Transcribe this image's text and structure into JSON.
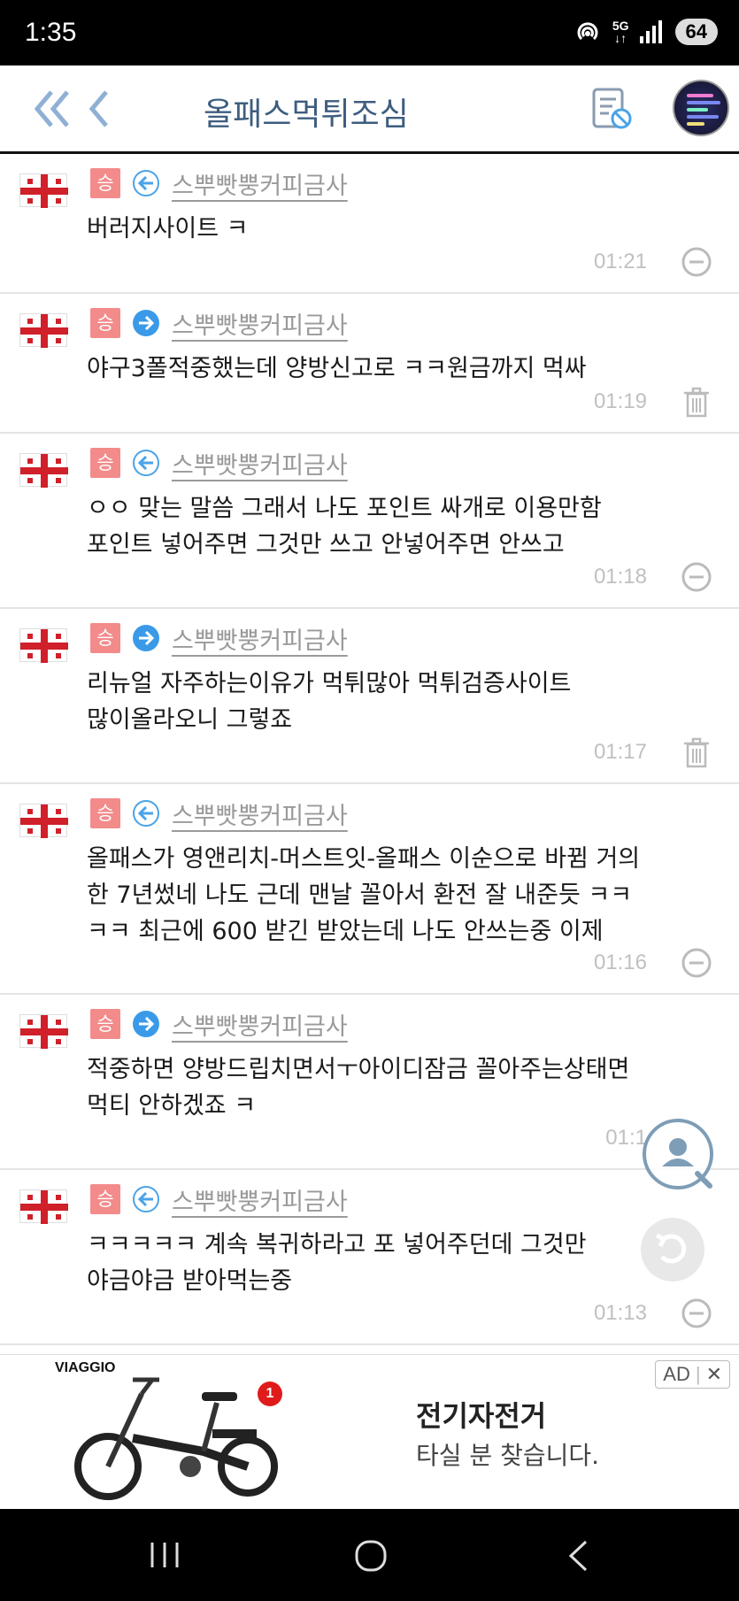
{
  "status_bar": {
    "time": "1:35",
    "network": "5G",
    "battery": "64"
  },
  "header": {
    "title": "올패스먹튀조심"
  },
  "comments": [
    {
      "badge": "승",
      "arrow": "left",
      "nickname": "스뿌빳뿡커피금사",
      "text": "버러지사이트 ㅋ",
      "time": "01:21",
      "action": "minus"
    },
    {
      "badge": "승",
      "arrow": "right",
      "nickname": "스뿌빳뿡커피금사",
      "text": "야구3폴적중했는데 양방신고로 ㅋㅋ원금까지 먹싸",
      "time": "01:19",
      "action": "trash"
    },
    {
      "badge": "승",
      "arrow": "left",
      "nickname": "스뿌빳뿡커피금사",
      "text": "ㅇㅇ 맞는 말씀 그래서 나도 포인트 싸개로 이용만함\n포인트 넣어주면 그것만 쓰고 안넣어주면 안쓰고",
      "time": "01:18",
      "action": "minus"
    },
    {
      "badge": "승",
      "arrow": "right",
      "nickname": "스뿌빳뿡커피금사",
      "text": "리뉴얼 자주하는이유가 먹튀많아 먹튀검증사이트\n많이올라오니 그렇죠",
      "time": "01:17",
      "action": "trash"
    },
    {
      "badge": "승",
      "arrow": "left",
      "nickname": "스뿌빳뿡커피금사",
      "text": "올패스가 영앤리치-머스트잇-올패스 이순으로 바뀜 거의\n한 7년썼네 나도 근데 맨날 꼴아서 환전 잘 내준듯 ㅋㅋ\nㅋㅋ 최근에 600 받긴 받았는데 나도 안쓰는중 이제",
      "time": "01:16",
      "action": "minus"
    },
    {
      "badge": "승",
      "arrow": "right",
      "nickname": "스뿌빳뿡커피금사",
      "text": "적중하면 양방드립치면서ㅜ아이디잠금  꼴아주는상태면\n먹티 안하겠죠 ㅋ",
      "time": "01:1",
      "action": "none"
    },
    {
      "badge": "승",
      "arrow": "left",
      "nickname": "스뿌빳뿡커피금사",
      "text": "ㅋㅋㅋㅋㅋ 계속 복귀하라고 포 넣어주던데 그것만\n야금야금 받아먹는중",
      "time": "01:13",
      "action": "minus"
    }
  ],
  "ad": {
    "brand": "VIAGGIO",
    "notification_count": "1",
    "headline": "전기자전거",
    "subtext": "타실 분 찾습니다.",
    "label": "AD",
    "close": "✕"
  }
}
